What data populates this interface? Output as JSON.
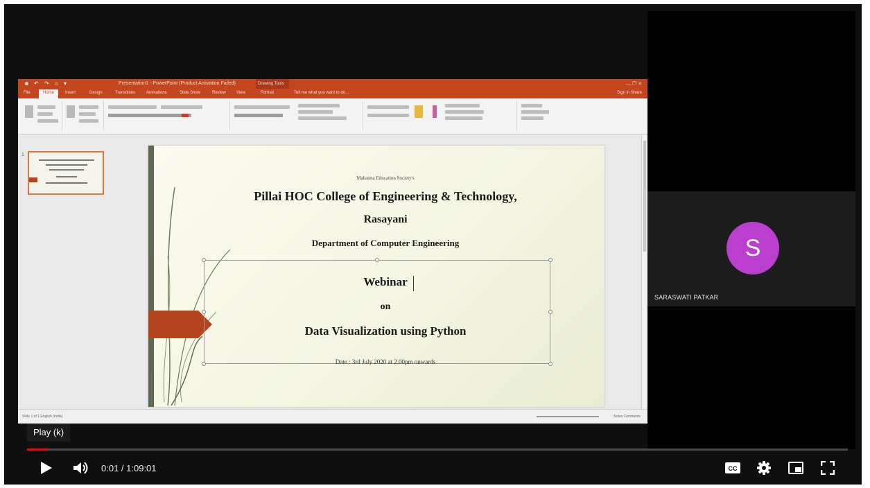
{
  "powerpoint": {
    "doc_title": "Presentation1 - PowerPoint (Product Activation Failed)",
    "contextual_tab": "Drawing Tools",
    "tabs": [
      "File",
      "Home",
      "Insert",
      "Design",
      "Transitions",
      "Animations",
      "Slide Show",
      "Review",
      "View",
      "Format"
    ],
    "tell_me": "Tell me what you want to do...",
    "user": "Sign in  Share",
    "slide_number": "1",
    "status_left": "Slide 1 of 1   English (India)",
    "status_right": "Notes   Comments"
  },
  "slide": {
    "org": "Mahatma Education Society's",
    "college": "Pillai HOC College of Engineering & Technology,",
    "city": "Rasayani",
    "department": "Department of Computer Engineering",
    "webinar": "Webinar",
    "on": "on",
    "topic": "Data Visualization using Python",
    "date": "Date : 3rd July 2020 at 2.00pm onwards"
  },
  "participant": {
    "initial": "S",
    "name": "SARASWATI PATKAR",
    "avatar_color": "#bb3fcf"
  },
  "player": {
    "tooltip": "Play (k)",
    "time": "0:01 / 1:09:01",
    "progress_fraction": 2e-05,
    "accent_color": "#ff0000",
    "icons": [
      "play-icon",
      "volume-icon",
      "subtitles-icon",
      "settings-icon",
      "miniplayer-icon",
      "fullscreen-icon"
    ]
  }
}
